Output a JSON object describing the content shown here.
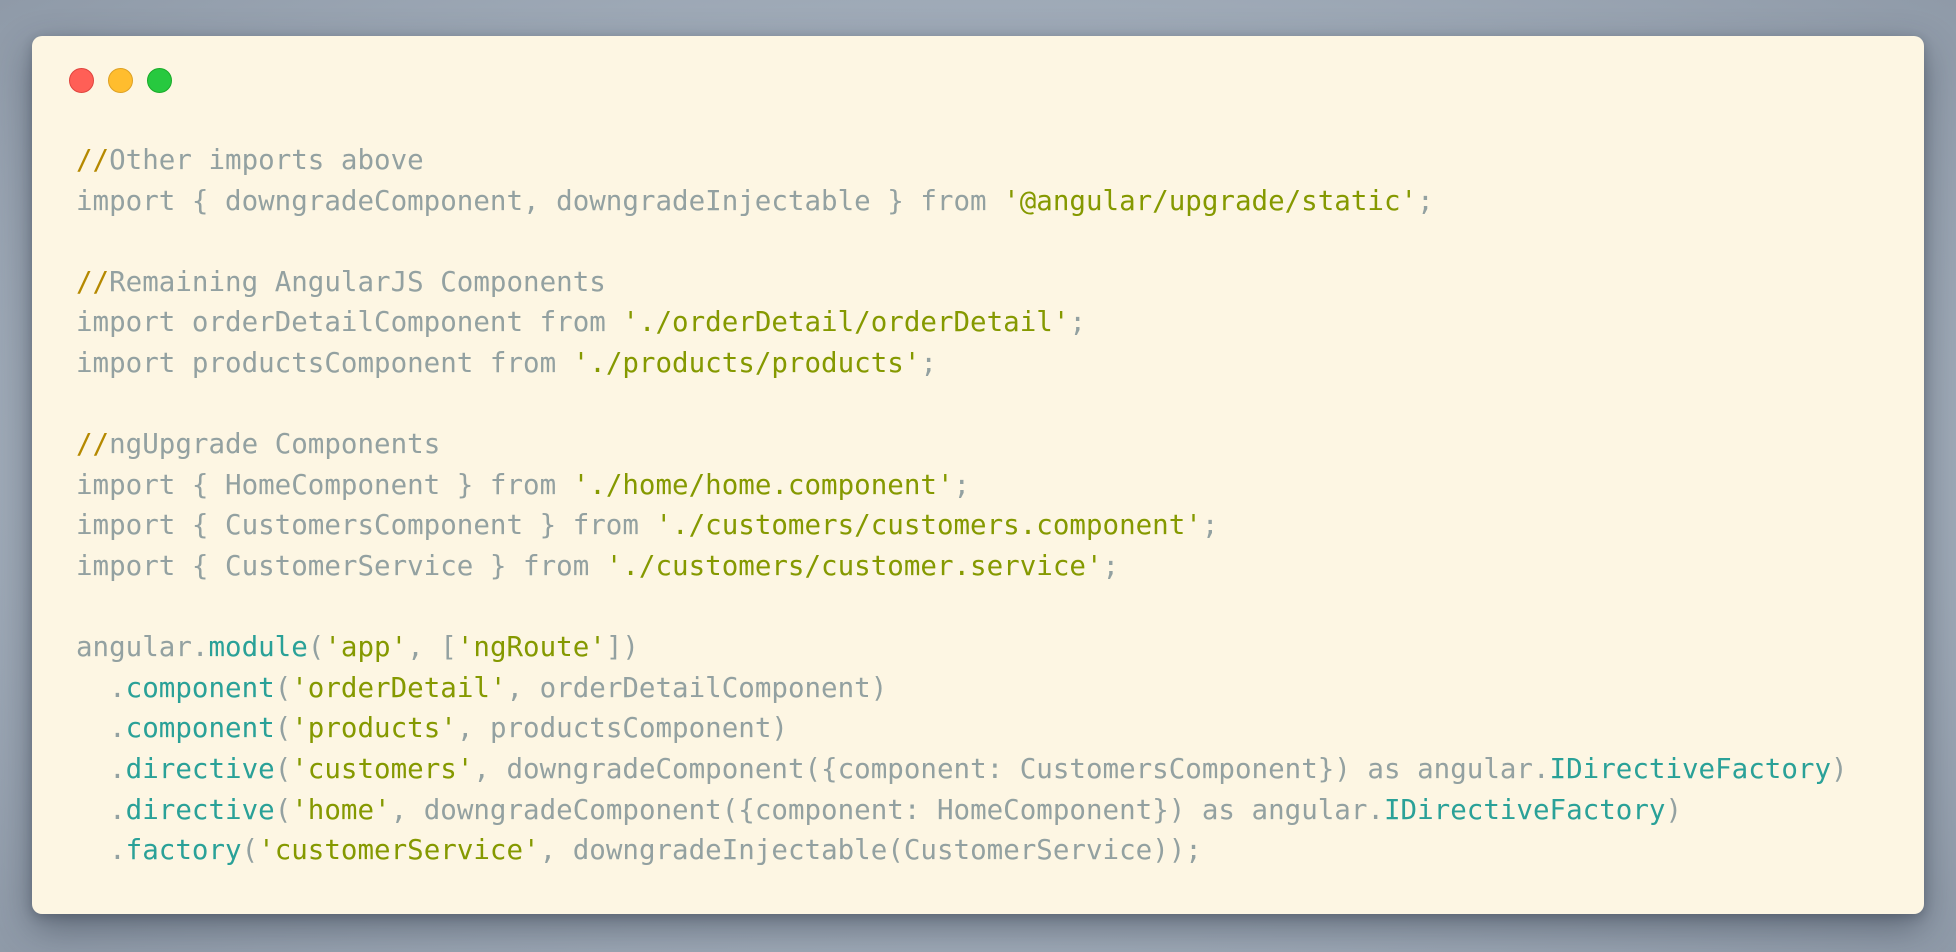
{
  "window": {
    "controls": [
      "close",
      "minimize",
      "maximize"
    ],
    "colors": {
      "background": "#fdf6e3",
      "close": "#ff5f56",
      "minimize": "#ffbd2e",
      "maximize": "#27c93f",
      "plain": "#93a1a1",
      "string": "#859900",
      "method": "#2aa198",
      "comment_marker": "#b58900"
    }
  },
  "code": {
    "language": "typescript",
    "lines": [
      [
        {
          "t": "//",
          "k": "comment-slash"
        },
        {
          "t": "Other imports above",
          "k": "comment"
        }
      ],
      [
        {
          "t": "import { downgradeComponent, downgradeInjectable } from ",
          "k": "plain"
        },
        {
          "t": "'@angular/upgrade/static'",
          "k": "string"
        },
        {
          "t": ";",
          "k": "punct"
        }
      ],
      [],
      [
        {
          "t": "//",
          "k": "comment-slash"
        },
        {
          "t": "Remaining AngularJS Components",
          "k": "comment"
        }
      ],
      [
        {
          "t": "import orderDetailComponent from ",
          "k": "plain"
        },
        {
          "t": "'./orderDetail/orderDetail'",
          "k": "string"
        },
        {
          "t": ";",
          "k": "punct"
        }
      ],
      [
        {
          "t": "import productsComponent from ",
          "k": "plain"
        },
        {
          "t": "'./products/products'",
          "k": "string"
        },
        {
          "t": ";",
          "k": "punct"
        }
      ],
      [],
      [
        {
          "t": "//",
          "k": "comment-slash"
        },
        {
          "t": "ngUpgrade Components",
          "k": "comment"
        }
      ],
      [
        {
          "t": "import { HomeComponent } from ",
          "k": "plain"
        },
        {
          "t": "'./home/home.component'",
          "k": "string"
        },
        {
          "t": ";",
          "k": "punct"
        }
      ],
      [
        {
          "t": "import { CustomersComponent } from ",
          "k": "plain"
        },
        {
          "t": "'./customers/customers.component'",
          "k": "string"
        },
        {
          "t": ";",
          "k": "punct"
        }
      ],
      [
        {
          "t": "import { CustomerService } from ",
          "k": "plain"
        },
        {
          "t": "'./customers/customer.service'",
          "k": "string"
        },
        {
          "t": ";",
          "k": "punct"
        }
      ],
      [],
      [
        {
          "t": "angular.",
          "k": "plain"
        },
        {
          "t": "module",
          "k": "method"
        },
        {
          "t": "(",
          "k": "punct"
        },
        {
          "t": "'app'",
          "k": "string"
        },
        {
          "t": ", [",
          "k": "punct"
        },
        {
          "t": "'ngRoute'",
          "k": "string"
        },
        {
          "t": "])",
          "k": "punct"
        }
      ],
      [
        {
          "t": "  .",
          "k": "plain"
        },
        {
          "t": "component",
          "k": "method"
        },
        {
          "t": "(",
          "k": "punct"
        },
        {
          "t": "'orderDetail'",
          "k": "string"
        },
        {
          "t": ", orderDetailComponent)",
          "k": "plain"
        }
      ],
      [
        {
          "t": "  .",
          "k": "plain"
        },
        {
          "t": "component",
          "k": "method"
        },
        {
          "t": "(",
          "k": "punct"
        },
        {
          "t": "'products'",
          "k": "string"
        },
        {
          "t": ", productsComponent)",
          "k": "plain"
        }
      ],
      [
        {
          "t": "  .",
          "k": "plain"
        },
        {
          "t": "directive",
          "k": "method"
        },
        {
          "t": "(",
          "k": "punct"
        },
        {
          "t": "'customers'",
          "k": "string"
        },
        {
          "t": ", downgradeComponent({component: CustomersComponent}) as angular.",
          "k": "plain"
        },
        {
          "t": "IDirectiveFactory",
          "k": "type"
        },
        {
          "t": ")",
          "k": "punct"
        }
      ],
      [
        {
          "t": "  .",
          "k": "plain"
        },
        {
          "t": "directive",
          "k": "method"
        },
        {
          "t": "(",
          "k": "punct"
        },
        {
          "t": "'home'",
          "k": "string"
        },
        {
          "t": ", downgradeComponent({component: HomeComponent}) as angular.",
          "k": "plain"
        },
        {
          "t": "IDirectiveFactory",
          "k": "type"
        },
        {
          "t": ")",
          "k": "punct"
        }
      ],
      [
        {
          "t": "  .",
          "k": "plain"
        },
        {
          "t": "factory",
          "k": "method"
        },
        {
          "t": "(",
          "k": "punct"
        },
        {
          "t": "'customerService'",
          "k": "string"
        },
        {
          "t": ", downgradeInjectable(CustomerService));",
          "k": "plain"
        }
      ]
    ]
  }
}
